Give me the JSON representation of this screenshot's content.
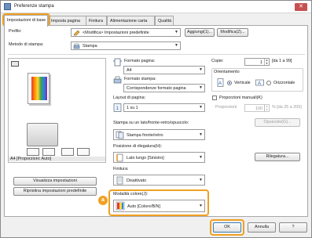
{
  "window": {
    "title": "Preferenze stampa",
    "close_glyph": "✕"
  },
  "tabs": [
    "Impostazioni di base",
    "Imposta pagina",
    "Finitura",
    "Alimentazione carta",
    "Qualità"
  ],
  "profile": {
    "label": "Profilo:",
    "value": "<Modifica> Impostazioni predefinite",
    "add_button": "Aggiungi(1)...",
    "edit_button": "Modifica(2)..."
  },
  "output_method": {
    "label": "Metodo di stampa:",
    "value": "Stampa"
  },
  "preview": {
    "caption": "A4 [Proporzioni: Auto]",
    "show_settings_button": "Visualizza impostazioni",
    "restore_defaults_button": "Ripristina impostazioni predefinite"
  },
  "page_size": {
    "label": "Formato pagina:",
    "value": "A4"
  },
  "output_size": {
    "label": "Formato stampa:",
    "value": "Corrispondenze formato pagina"
  },
  "copies": {
    "label": "Copie:",
    "value": "1",
    "range": "[da 1 a 99]"
  },
  "orientation": {
    "label": "Orientamento",
    "portrait": "Verticale",
    "landscape": "Orizzontale",
    "selected": "Verticale"
  },
  "page_layout": {
    "label": "Layout di pagina:",
    "value": "1 su 1"
  },
  "manual_scaling": {
    "label": "Proporzioni manuali(K)",
    "scaling_label": "Proporzioni",
    "scaling_value": "100",
    "scaling_range": "% [da 25 a 200]",
    "options_button": "Opuscolo(G)..."
  },
  "duplex": {
    "label": "Stampa su un lato/fronte-retro/opuscolo:",
    "value": "Stampa fronte/retro"
  },
  "binding": {
    "label": "Posizione di rilegatura(H):",
    "value": "Lato lungo [Sinistro]",
    "button": "Rilegatura..."
  },
  "finishing": {
    "label": "Finitura:",
    "value": "Disattivato"
  },
  "color_mode": {
    "label": "Modalità colore(J):",
    "value": "Auto [Colore/B/N]",
    "callout": "a"
  },
  "footer": {
    "ok": "OK",
    "cancel": "Annulla",
    "help": "?"
  },
  "colors": {
    "accent_orange": "#f0a020",
    "title_close": "#c75050"
  }
}
